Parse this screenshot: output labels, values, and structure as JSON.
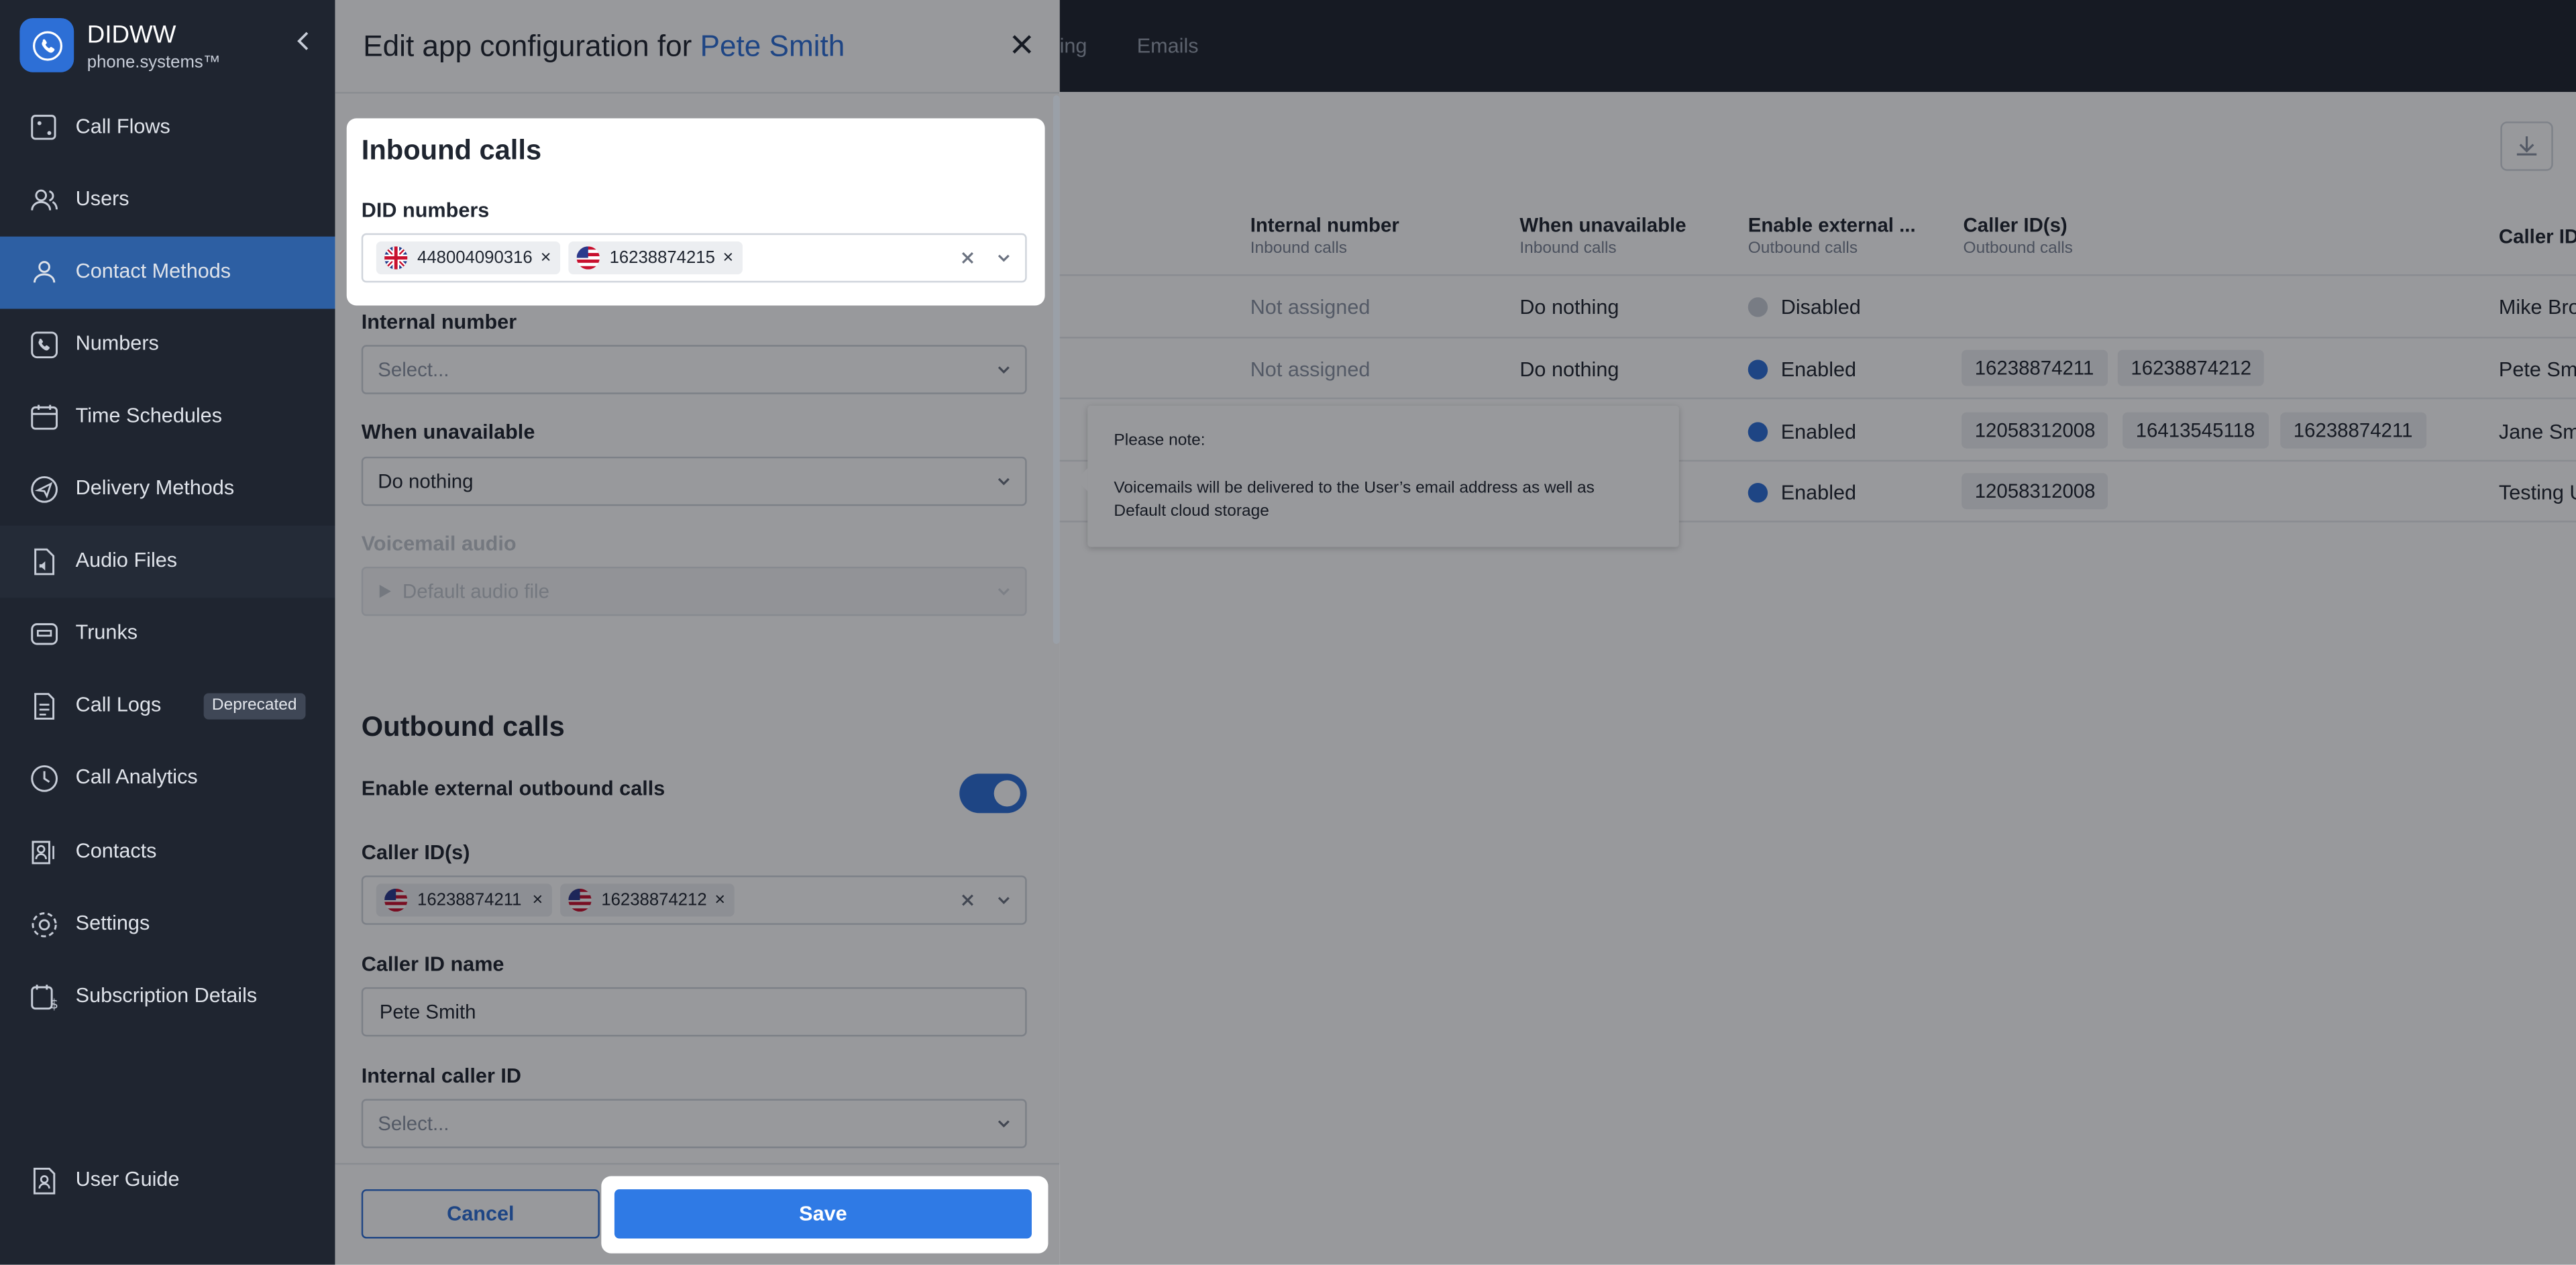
{
  "app": {
    "brand_title": "DIDWW",
    "brand_subtitle": "phone.systems™",
    "accent_color": "#2d6fd6"
  },
  "sidebar": {
    "items": [
      {
        "label": "Call Flows",
        "icon": "call-flows-icon"
      },
      {
        "label": "Users",
        "icon": "users-icon"
      },
      {
        "label": "Contact Methods",
        "icon": "contact-methods-icon",
        "active": true
      },
      {
        "label": "Numbers",
        "icon": "numbers-icon"
      },
      {
        "label": "Time Schedules",
        "icon": "calendar-icon"
      },
      {
        "label": "Delivery Methods",
        "icon": "send-icon"
      },
      {
        "label": "Audio Files",
        "icon": "audio-file-icon"
      },
      {
        "label": "Trunks",
        "icon": "trunks-icon"
      },
      {
        "label": "Call Logs",
        "icon": "call-logs-icon",
        "badge": "Deprecated"
      },
      {
        "label": "Call Analytics",
        "icon": "analytics-icon"
      },
      {
        "label": "Contacts",
        "icon": "contacts-icon"
      },
      {
        "label": "Settings",
        "icon": "gear-icon"
      },
      {
        "label": "Subscription Details",
        "icon": "subscription-icon"
      }
    ],
    "footer_item": {
      "label": "User Guide",
      "icon": "user-guide-icon"
    }
  },
  "topbar": {
    "tabs": [
      "ing",
      "Emails"
    ]
  },
  "table": {
    "columns": [
      {
        "title": "Internal number",
        "sub": "Inbound calls"
      },
      {
        "title": "When unavailable",
        "sub": "Inbound calls"
      },
      {
        "title": "Enable external ...",
        "sub": "Outbound calls"
      },
      {
        "title": "Caller ID(s)",
        "sub": "Outbound calls"
      },
      {
        "title": "Caller ID",
        "sub": ""
      }
    ],
    "rows": [
      {
        "internal": "Not assigned",
        "unavailable": "Do nothing",
        "external": "Disabled",
        "external_on": false,
        "caller_ids": [],
        "caller_name": "Mike Brow"
      },
      {
        "internal": "Not assigned",
        "unavailable": "Do nothing",
        "external": "Enabled",
        "external_on": true,
        "caller_ids": [
          "16238874211",
          "16238874212"
        ],
        "caller_name": "Pete Smi"
      },
      {
        "internal": "",
        "unavailable": "",
        "external": "Enabled",
        "external_on": true,
        "caller_ids": [
          "12058312008",
          "16413545118",
          "16238874211"
        ],
        "caller_name": "Jane Smi"
      },
      {
        "internal": "",
        "unavailable": "",
        "external": "Enabled",
        "external_on": true,
        "caller_ids": [
          "12058312008"
        ],
        "caller_name": "Testing U"
      }
    ]
  },
  "tooltip": {
    "title": "Please note:",
    "body": "Voicemails will be delivered to the User’s email address as well as Default cloud storage"
  },
  "drawer": {
    "title_prefix": "Edit app configuration for ",
    "title_user": "Pete Smith",
    "inbound": {
      "heading": "Inbound calls",
      "did_label": "DID numbers",
      "did_tags": [
        {
          "flag": "uk-flag-icon",
          "number": "448004090316"
        },
        {
          "flag": "us-flag-icon",
          "number": "16238874215"
        }
      ],
      "internal_label": "Internal number",
      "internal_placeholder": "Select...",
      "unavailable_label": "When unavailable",
      "unavailable_value": "Do nothing",
      "voicemail_label": "Voicemail audio",
      "voicemail_value": "Default audio file"
    },
    "outbound": {
      "heading": "Outbound calls",
      "external_label": "Enable external outbound calls",
      "external_enabled": true,
      "caller_ids_label": "Caller ID(s)",
      "caller_id_tags": [
        {
          "flag": "us-flag-icon",
          "number": "16238874211"
        },
        {
          "flag": "us-flag-icon",
          "number": "16238874212"
        }
      ],
      "caller_name_label": "Caller ID name",
      "caller_name_value": "Pete Smith",
      "internal_caller_label": "Internal caller ID",
      "internal_caller_placeholder": "Select..."
    },
    "cancel_label": "Cancel",
    "save_label": "Save"
  }
}
